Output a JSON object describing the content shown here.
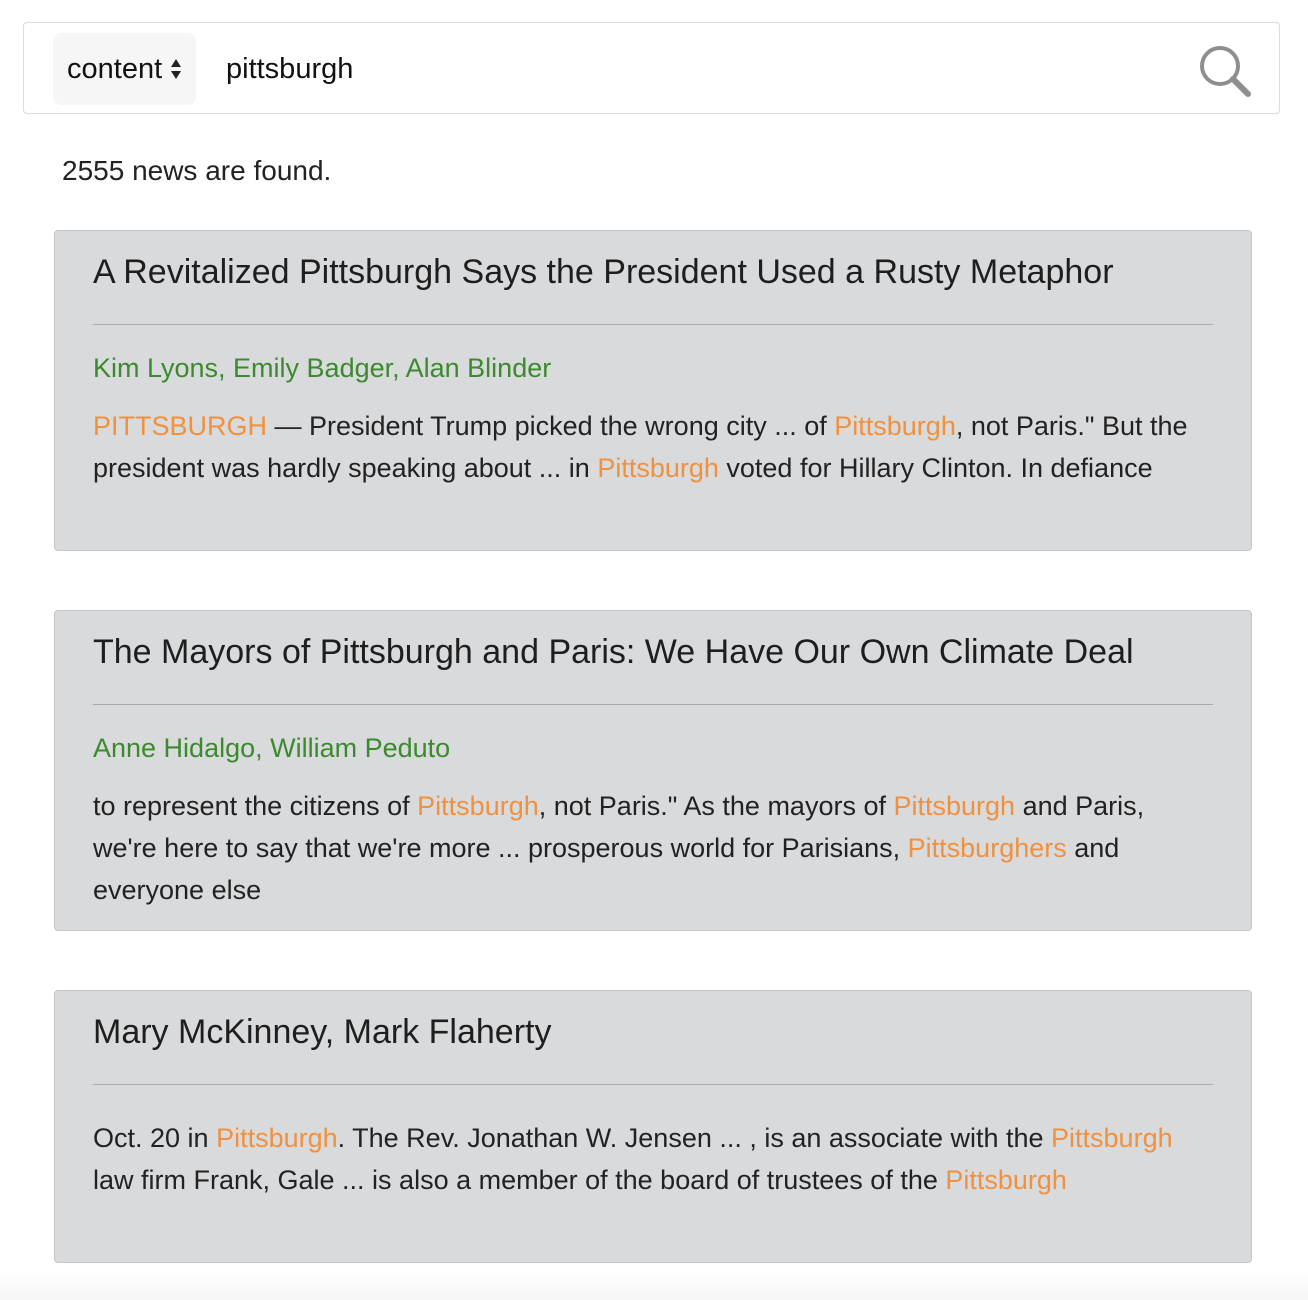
{
  "search": {
    "field_label": "content",
    "query": "pittsburgh",
    "search_icon": "search-icon"
  },
  "results": {
    "count_text": "2555 news are found."
  },
  "articles": [
    {
      "title": "A Revitalized Pittsburgh Says the President Used a Rusty Metaphor",
      "authors": "Kim Lyons, Emily Badger, Alan Blinder",
      "snippet": [
        {
          "text": "PITTSBURGH",
          "hl": true
        },
        {
          "text": " — President Trump picked the wrong city ... of ",
          "hl": false
        },
        {
          "text": "Pittsburgh",
          "hl": true
        },
        {
          "text": ", not Paris.\" But the president was hardly speaking about ... in ",
          "hl": false
        },
        {
          "text": "Pittsburgh",
          "hl": true
        },
        {
          "text": " voted for Hillary Clinton. In defiance",
          "hl": false
        }
      ]
    },
    {
      "title": "The Mayors of Pittsburgh and Paris: We Have Our Own Climate Deal",
      "authors": "Anne Hidalgo, William Peduto",
      "snippet": [
        {
          "text": "to represent the citizens of ",
          "hl": false
        },
        {
          "text": "Pittsburgh",
          "hl": true
        },
        {
          "text": ", not Paris.\" As the mayors of ",
          "hl": false
        },
        {
          "text": "Pittsburgh",
          "hl": true
        },
        {
          "text": " and Paris, we're here to say that we're more ... prosperous world for Parisians, ",
          "hl": false
        },
        {
          "text": "Pittsburghers",
          "hl": true
        },
        {
          "text": " and everyone else",
          "hl": false
        }
      ]
    },
    {
      "title": "Mary McKinney, Mark Flaherty",
      "authors": "",
      "snippet": [
        {
          "text": "Oct. 20 in ",
          "hl": false
        },
        {
          "text": "Pittsburgh",
          "hl": true
        },
        {
          "text": ". The Rev. Jonathan W. Jensen ... , is an associate with the ",
          "hl": false
        },
        {
          "text": "Pittsburgh",
          "hl": true
        },
        {
          "text": " law firm Frank, Gale ... is also a member of the board of trustees of the ",
          "hl": false
        },
        {
          "text": "Pittsburgh",
          "hl": true
        }
      ]
    }
  ],
  "colors": {
    "highlight": "#f0913f",
    "authors": "#3c8a2e",
    "card_bg": "#d9dadc"
  }
}
